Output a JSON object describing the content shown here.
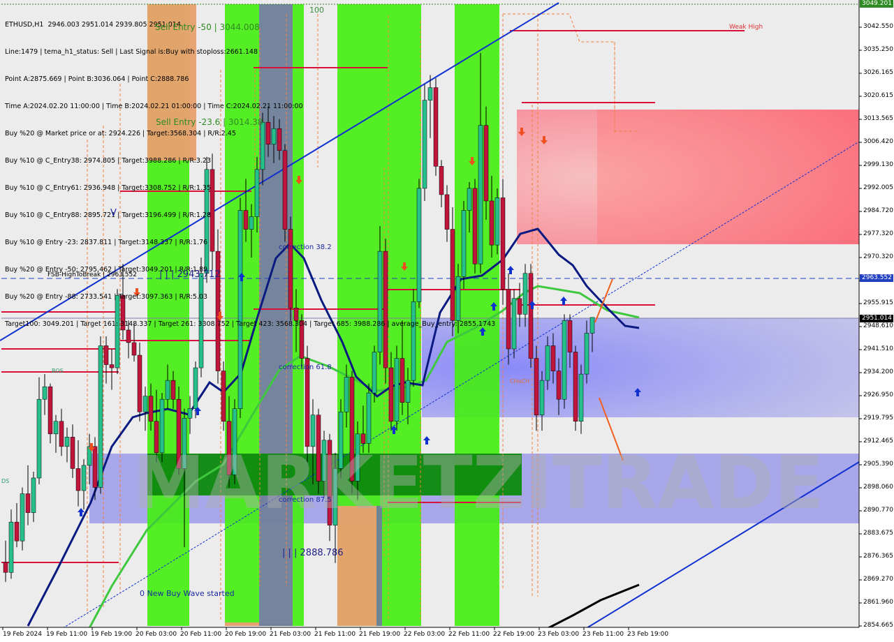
{
  "window": {
    "symbol_line": "ETHUSD,H1  2946.003 2951.014 2939.805 2951.014"
  },
  "info_lines": [
    "Line:1479 | tema_h1_status: Sell | Last Signal is:Buy with stoploss:2661.148",
    "Point A:2875.669 | Point B:3036.064 | Point C:2888.786",
    "Time A:2024.02.20 11:00:00 | Time B:2024.02.21 01:00:00 | Time C:2024.02.21 11:00:00",
    "Buy %20 @ Market price or at: 2924.226 | Target:3568.304 | R/R:2.45",
    "Buy %10 @ C_Entry38: 2974.805 | Target:3988.286 | R/R:3.23",
    "Buy %10 @ C_Entry61: 2936.948 | Target:3308.752 | R/R:1.35",
    "Buy %10 @ C_Entry88: 2895.721 | Target:3196.499 | R/R:1.28",
    "Buy %10 @ Entry -23: 2837.811 | Target:3148.337 | R/R:1.76",
    "Buy %20 @ Entry -50: 2795.462 | Target:3049.201 | R/R:1.89",
    "Buy %20 @ Entry -88: 2733.541 | Target:3097.363 | R/R:5.03",
    "Target100: 3049.201 | Target 161: 3148.337 | Target 261: 3308.752 | Target 423: 3568.304 | Target 685: 3988.286 | average_Buy_entry: 2855.1743"
  ],
  "labels": {
    "sell_entry_50": "Sell Entry -50 | 3044.008",
    "sell_entry_23": "Sell Entry -23.6 | 3014.38",
    "weak_high": "Weak High",
    "fsb": "FSB-HighToBreak | 2963.552",
    "level_2943": "| | | 2943.712",
    "correction_382": "correction 38.2",
    "correction_618": "correction 61.8",
    "correction_875": "correction 87.5",
    "level_2888": "| | | 2888.786",
    "new_buy_wave": "0 New Buy Wave started",
    "v_mark": "V",
    "hundred": "100",
    "bos": "BOS",
    "ds": "DS",
    "choch": "CHoCH",
    "watermark": "MARKETZITRADE"
  },
  "colors": {
    "green_zone": "#44ee10",
    "dark_green": "#0c8a0c",
    "orange_zone": "#e9a070",
    "gray_zone": "#70809a",
    "red_zone": "#f47a80",
    "blue_zone": "#7d7cf0",
    "bull_candle": "#26c08a",
    "bear_candle": "#c0143c",
    "tema_line": "#0a1a80",
    "ma_line": "#3ec83e",
    "channel": "#1030d0"
  },
  "chart_data": {
    "type": "candlestick",
    "symbol": "ETHUSD",
    "timeframe": "H1",
    "ohlc_header": {
      "open": 2946.003,
      "high": 2951.014,
      "low": 2939.805,
      "close": 2951.014
    },
    "y_ticks": [
      "3049.201",
      "3042.550",
      "3035.250",
      "3026.165",
      "3020.615",
      "3013.565",
      "3006.420",
      "2999.130",
      "2992.005",
      "2984.720",
      "2977.320",
      "2970.320",
      "2963.552",
      "2955.915",
      "2951.014",
      "2948.610",
      "2941.510",
      "2934.200",
      "2926.950",
      "2919.795",
      "2912.465",
      "2905.390",
      "2898.060",
      "2890.770",
      "2883.675",
      "2876.365",
      "2869.270",
      "2861.960",
      "2854.665"
    ],
    "x_ticks": [
      "19 Feb 2024",
      "19 Feb 11:00",
      "19 Feb 19:00",
      "20 Feb 03:00",
      "20 Feb 11:00",
      "20 Feb 19:00",
      "21 Feb 03:00",
      "21 Feb 11:00",
      "21 Feb 19:00",
      "22 Feb 03:00",
      "22 Feb 11:00",
      "22 Feb 19:00",
      "23 Feb 03:00",
      "23 Feb 11:00",
      "23 Feb 19:00"
    ],
    "price_labels": {
      "top": "3049.201",
      "fsb": "2963.552",
      "current": "2951.014"
    },
    "ylim": [
      2853.0,
      3050.5
    ],
    "candles": [
      [
        2873.2,
        2880.1,
        2867.0,
        2870.0
      ],
      [
        2870.0,
        2890.0,
        2868.0,
        2886.0
      ],
      [
        2886.0,
        2892.0,
        2878.0,
        2880.0
      ],
      [
        2880.0,
        2897.0,
        2877.0,
        2895.0
      ],
      [
        2895.0,
        2904.0,
        2885.0,
        2889.0
      ],
      [
        2889.0,
        2902.0,
        2886.0,
        2900.0
      ],
      [
        2900.0,
        2932.0,
        2898.0,
        2925.0
      ],
      [
        2925.0,
        2933.0,
        2920.0,
        2929.0
      ],
      [
        2929.0,
        2930.0,
        2911.0,
        2914.0
      ],
      [
        2914.0,
        2920.0,
        2908.0,
        2918.0
      ],
      [
        2918.0,
        2922.0,
        2907.0,
        2910.0
      ],
      [
        2910.0,
        2916.0,
        2905.0,
        2913.0
      ],
      [
        2913.0,
        2917.0,
        2900.0,
        2903.0
      ],
      [
        2903.0,
        2912.0,
        2891.0,
        2896.0
      ],
      [
        2896.0,
        2906.0,
        2890.0,
        2904.0
      ],
      [
        2904.0,
        2914.0,
        2898.0,
        2910.0
      ],
      [
        2910.0,
        2913.0,
        2893.0,
        2897.0
      ],
      [
        2897.0,
        2945.0,
        2895.0,
        2942.0
      ],
      [
        2942.0,
        2945.0,
        2930.0,
        2936.0
      ],
      [
        2936.0,
        2941.0,
        2928.0,
        2935.0
      ],
      [
        2935.0,
        2960.0,
        2933.0,
        2958.0
      ],
      [
        2958.0,
        2968.0,
        2944.0,
        2947.0
      ],
      [
        2947.0,
        2950.0,
        2938.0,
        2943.0
      ],
      [
        2943.0,
        2949.0,
        2937.0,
        2939.0
      ],
      [
        2939.0,
        2943.0,
        2918.0,
        2921.0
      ],
      [
        2921.0,
        2929.0,
        2915.0,
        2926.0
      ],
      [
        2926.0,
        2930.0,
        2915.0,
        2918.0
      ],
      [
        2918.0,
        2928.0,
        2905.0,
        2908.0
      ],
      [
        2908.0,
        2927.0,
        2905.0,
        2925.0
      ],
      [
        2925.0,
        2936.0,
        2922.0,
        2931.0
      ],
      [
        2931.0,
        2934.0,
        2922.0,
        2925.0
      ],
      [
        2925.0,
        2929.0,
        2901.0,
        2903.0
      ],
      [
        2903.0,
        2922.0,
        2878.0,
        2919.0
      ],
      [
        2919.0,
        2926.0,
        2914.0,
        2922.0
      ],
      [
        2922.0,
        2937.0,
        2919.0,
        2935.0
      ],
      [
        2935.0,
        2970.0,
        2932.0,
        2965.0
      ],
      [
        2965.0,
        3002.0,
        2962.0,
        2998.0
      ],
      [
        2998.0,
        3003.0,
        2966.0,
        2972.0
      ],
      [
        2972.0,
        2979.0,
        2930.0,
        2934.0
      ],
      [
        2934.0,
        2937.0,
        2915.0,
        2918.0
      ],
      [
        2918.0,
        2926.0,
        2897.0,
        2901.0
      ],
      [
        2901.0,
        2925.0,
        2898.0,
        2922.0
      ],
      [
        2922.0,
        2989.0,
        2919.0,
        2985.0
      ],
      [
        2985.0,
        2995.0,
        2975.0,
        2979.0
      ],
      [
        2979.0,
        2987.0,
        2970.0,
        2983.0
      ],
      [
        2983.0,
        3002.0,
        2978.0,
        2998.0
      ],
      [
        2998.0,
        3016.0,
        2993.0,
        3013.0
      ],
      [
        3013.0,
        3018.0,
        3002.0,
        3006.0
      ],
      [
        3006.0,
        3015.0,
        3000.0,
        3011.0
      ],
      [
        3011.0,
        3014.0,
        3001.0,
        3004.0
      ],
      [
        3004.0,
        3006.0,
        2975.0,
        2979.0
      ],
      [
        2979.0,
        2983.0,
        2950.0,
        2954.0
      ],
      [
        2954.0,
        2960.0,
        2940.0,
        2950.0
      ],
      [
        2950.0,
        2952.0,
        2935.0,
        2938.0
      ],
      [
        2938.0,
        2942.0,
        2905.0,
        2910.0
      ],
      [
        2910.0,
        2925.0,
        2898.0,
        2920.0
      ],
      [
        2920.0,
        2922.0,
        2895.0,
        2899.0
      ],
      [
        2899.0,
        2915.0,
        2894.0,
        2912.0
      ],
      [
        2912.0,
        2914.0,
        2880.0,
        2885.0
      ],
      [
        2885.0,
        2908.0,
        2873.0,
        2903.0
      ],
      [
        2903.0,
        2925.0,
        2900.0,
        2921.0
      ],
      [
        2921.0,
        2936.0,
        2916.0,
        2932.0
      ],
      [
        2932.0,
        2934.0,
        2895.0,
        2899.0
      ],
      [
        2899.0,
        2918.0,
        2893.0,
        2914.0
      ],
      [
        2914.0,
        2923.0,
        2908.0,
        2911.0
      ],
      [
        2911.0,
        2930.0,
        2908.0,
        2927.0
      ],
      [
        2927.0,
        2942.0,
        2924.0,
        2940.0
      ],
      [
        2940.0,
        2980.0,
        2936.0,
        2972.0
      ],
      [
        2972.0,
        2976.0,
        2930.0,
        2935.0
      ],
      [
        2935.0,
        2940.0,
        2915.0,
        2918.0
      ],
      [
        2918.0,
        2942.0,
        2915.0,
        2938.0
      ],
      [
        2938.0,
        2950.0,
        2920.0,
        2924.0
      ],
      [
        2924.0,
        2935.0,
        2917.0,
        2931.0
      ],
      [
        2931.0,
        2960.0,
        2929.0,
        2956.0
      ],
      [
        2956.0,
        2995.0,
        2954.0,
        2992.0
      ],
      [
        2992.0,
        3025.0,
        2988.0,
        3020.0
      ],
      [
        3020.0,
        3028.0,
        3008.0,
        3024.0
      ],
      [
        3024.0,
        3027.0,
        2996.0,
        2999.0
      ],
      [
        2999.0,
        3001.0,
        2986.0,
        2990.0
      ],
      [
        2990.0,
        2993.0,
        2975.0,
        2979.0
      ],
      [
        2979.0,
        2986.0,
        2945.0,
        2950.0
      ],
      [
        2950.0,
        2968.0,
        2946.0,
        2964.0
      ],
      [
        2964.0,
        2988.0,
        2960.0,
        2985.0
      ],
      [
        2985.0,
        2994.0,
        2978.0,
        2992.0
      ],
      [
        2992.0,
        2995.0,
        2965.0,
        2968.0
      ],
      [
        2968.0,
        3035.0,
        2965.0,
        3012.0
      ],
      [
        3012.0,
        3018.0,
        2982.0,
        2988.0
      ],
      [
        2988.0,
        2996.0,
        2970.0,
        2974.0
      ],
      [
        2974.0,
        2992.0,
        2971.0,
        2989.0
      ],
      [
        2989.0,
        2995.0,
        2955.0,
        2960.0
      ],
      [
        2960.0,
        2965.0,
        2936.0,
        2941.0
      ],
      [
        2941.0,
        2960.0,
        2938.0,
        2957.0
      ],
      [
        2957.0,
        2962.0,
        2948.0,
        2952.0
      ],
      [
        2952.0,
        2968.0,
        2948.0,
        2965.0
      ],
      [
        2965.0,
        2968.0,
        2935.0,
        2938.0
      ],
      [
        2938.0,
        2942.0,
        2915.0,
        2920.0
      ],
      [
        2920.0,
        2934.0,
        2915.0,
        2931.0
      ],
      [
        2931.0,
        2945.0,
        2928.0,
        2942.0
      ],
      [
        2942.0,
        2946.0,
        2930.0,
        2934.0
      ],
      [
        2934.0,
        2938.0,
        2920.0,
        2925.0
      ],
      [
        2925.0,
        2952.0,
        2922.0,
        2950.0
      ],
      [
        2950.0,
        2952.0,
        2935.0,
        2940.0
      ],
      [
        2940.0,
        2942.0,
        2915.0,
        2918.0
      ],
      [
        2918.0,
        2936.0,
        2914.0,
        2933.0
      ],
      [
        2933.0,
        2950.0,
        2930.0,
        2946.0
      ],
      [
        2946.0,
        2951.0,
        2940.0,
        2951.0
      ]
    ]
  }
}
